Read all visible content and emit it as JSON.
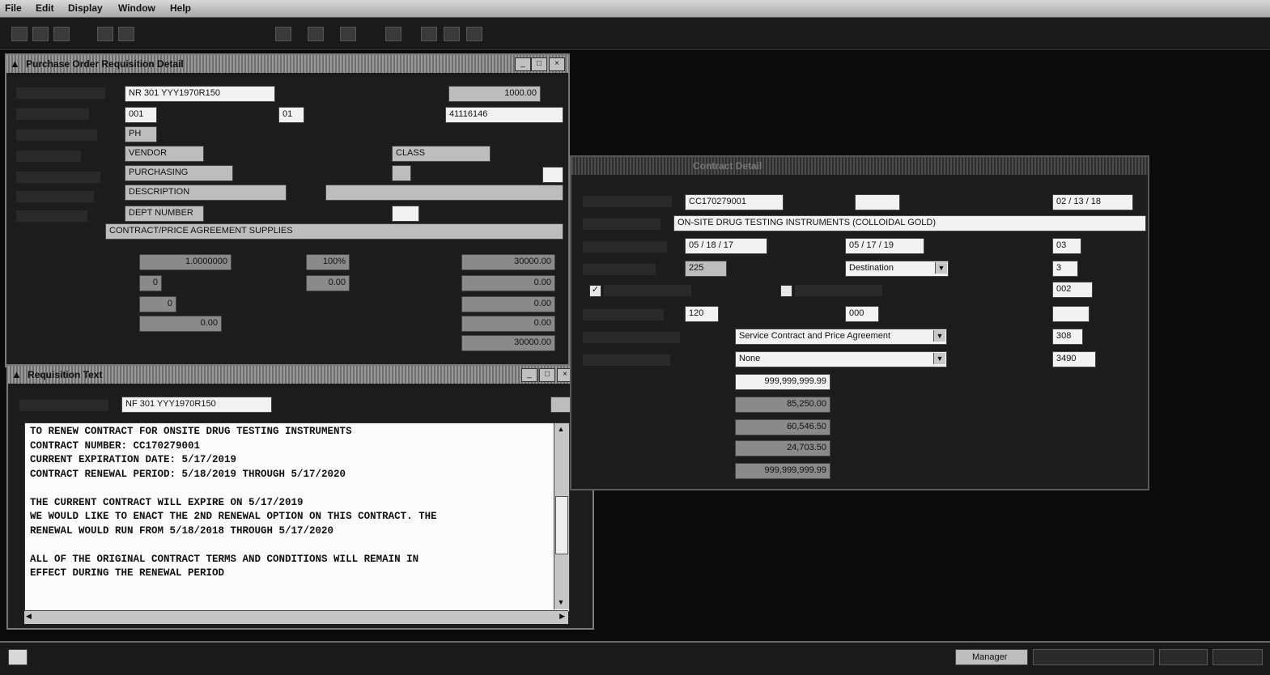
{
  "menubar": {
    "items": [
      "File",
      "Edit",
      "Display",
      "Window",
      "Help"
    ]
  },
  "purchase_order_window": {
    "title": "Purchase Order Requisition Detail",
    "fields": {
      "requisition_number": "NR 301 YYY1970R150",
      "number_right": "1000.00",
      "line": "001",
      "sub": "01",
      "account": "41116146",
      "row3": "PH",
      "row4": "VENDOR",
      "vendor_right": "CLASS",
      "row5": "PURCHASING",
      "row6_left": "DESCRIPTION",
      "row6_right": "",
      "row7": "DEPT NUMBER",
      "commodity": "CONTRACT/PRICE AGREEMENT SUPPLIES",
      "qty_left": "1.0000000",
      "qty_mid": "100%",
      "amount1": "30000.00",
      "r2_left": "0",
      "r2_mid": "0.00",
      "amount2": "0.00",
      "r3_left": "0",
      "amount3": "0.00",
      "r4_left": "0.00",
      "amount4": "0.00",
      "amount5": "30000.00"
    }
  },
  "contract_window": {
    "title": "Contract Detail",
    "contract_number": "CC170279001",
    "date_top": "02 / 13 / 18",
    "description": "ON-SITE DRUG TESTING INSTRUMENTS (COLLOIDAL GOLD)",
    "start_date": "05 / 18 / 17",
    "end_date": "05 / 17 / 19",
    "field_right_1": "03",
    "field_left_2": "225",
    "fob_select": "Destination",
    "field_right_2": "3",
    "checkbox1_checked": true,
    "checkbox2_checked": false,
    "field_right_3": "002",
    "days": "120",
    "field_mid_4": "000",
    "field_right_4": "",
    "contract_type_select": "Service Contract and Price Agreement",
    "field_right_5": "308",
    "option_select": "None",
    "field_right_6": "3490",
    "amount_limit": "999,999,999.99",
    "amount_a": "85,250.00",
    "amount_b": "60,546.50",
    "amount_c": "24,703.50",
    "amount_d": "999,999,999.99"
  },
  "memo_window": {
    "title": "Requisition Text",
    "requisition_number": "NF 301 YYY1970R150",
    "lines": [
      "TO RENEW CONTRACT FOR ONSITE DRUG TESTING INSTRUMENTS",
      "CONTRACT NUMBER: CC170279001",
      "CURRENT EXPIRATION DATE: 5/17/2019",
      "CONTRACT RENEWAL PERIOD: 5/18/2019 THROUGH 5/17/2020",
      "",
      "THE CURRENT CONTRACT WILL EXPIRE ON 5/17/2019",
      "WE WOULD LIKE TO ENACT THE 2ND RENEWAL OPTION ON THIS CONTRACT. THE",
      "RENEWAL WOULD RUN FROM 5/18/2018 THROUGH 5/17/2020",
      "",
      "ALL OF THE ORIGINAL CONTRACT TERMS AND CONDITIONS WILL REMAIN IN",
      "EFFECT DURING THE RENEWAL PERIOD"
    ]
  },
  "taskbar": {
    "item": "Manager"
  }
}
